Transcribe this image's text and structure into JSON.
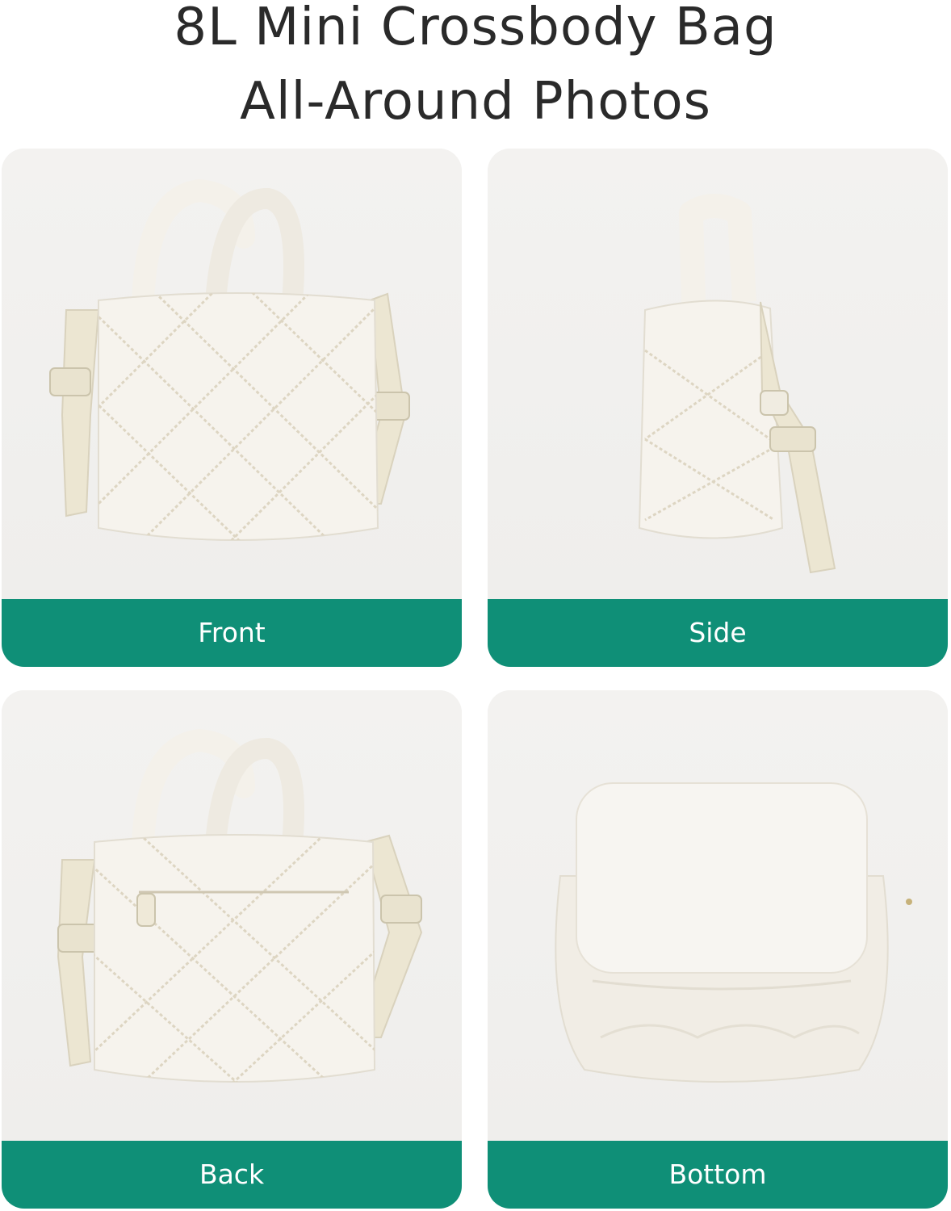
{
  "header": {
    "line1": "8L Mini Crossbody Bag",
    "line2": "All-Around Photos"
  },
  "views": [
    {
      "label": "Front"
    },
    {
      "label": "Side"
    },
    {
      "label": "Back"
    },
    {
      "label": "Bottom"
    }
  ],
  "colors": {
    "label_bar": "#0f8f77",
    "card_bg": "#f2f1ef",
    "bag": "#f4f1ea",
    "strap": "#ece6d2"
  }
}
